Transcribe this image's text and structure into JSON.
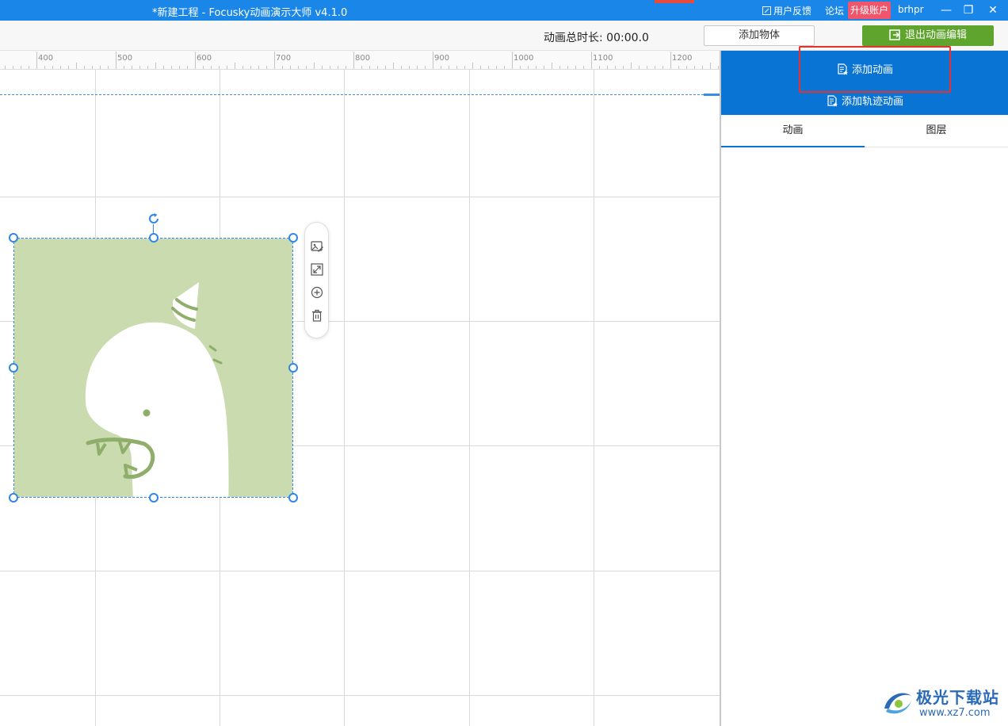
{
  "window": {
    "title": "*新建工程 - Focusky动画演示大师  v4.1.0",
    "feedback": "用户反馈",
    "forum": "论坛",
    "upgrade": "升级账户",
    "username": "brhpr",
    "minimize": "—",
    "restore": "❐",
    "close": "✕"
  },
  "toolbar": {
    "duration": "动画总时长: 00:00.0",
    "add_object": "添加物体",
    "exit_edit": "退出动画编辑"
  },
  "ruler": {
    "labels": [
      "400",
      "500",
      "600",
      "700",
      "800",
      "900",
      "1000",
      "1100",
      "1200"
    ]
  },
  "panel": {
    "add_animation": "添加动画",
    "add_path_animation": "添加轨迹动画",
    "tabs": [
      {
        "label": "动画",
        "active": true
      },
      {
        "label": "图层",
        "active": false
      }
    ]
  },
  "watermark": {
    "text": "极光下载站",
    "url": "www.xz7.com"
  },
  "colors": {
    "titlebar": "#1a87e8",
    "panel_header": "#0a74d4",
    "exit_button": "#5fa42c",
    "highlight": "#e5322c",
    "image_bg": "#cadcaf",
    "selection": "#2f86e8"
  }
}
